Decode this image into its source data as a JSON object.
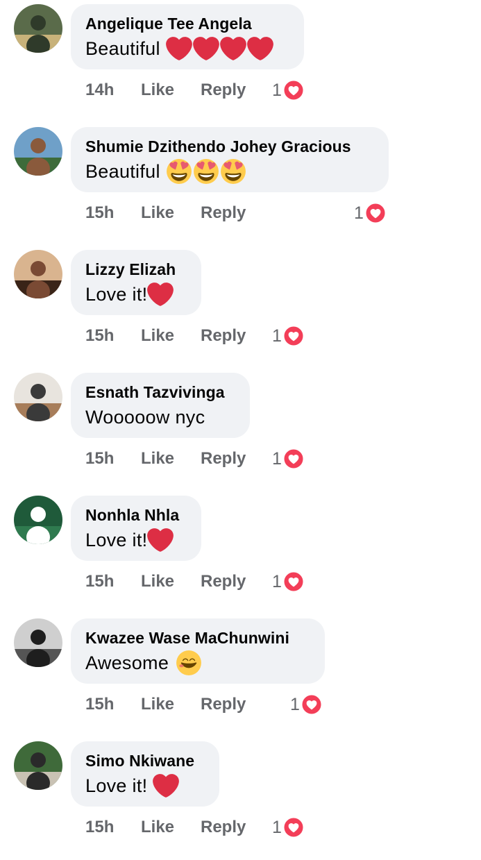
{
  "comments": [
    {
      "author": "Angelique Tee Angela",
      "text": "Beautiful",
      "emoji": "red-heart-icon",
      "emoji_count": 4,
      "time": "14h",
      "like": "Like",
      "reply": "Reply",
      "reaction_count": "1",
      "avatar_colors": [
        "#5a6b4a",
        "#c8b27a",
        "#2f3a2a"
      ]
    },
    {
      "author": "Shumie Dzithendo Johey Gracious",
      "text": "Beautiful",
      "emoji": "heart-eyes-face-icon",
      "emoji_count": 3,
      "time": "15h",
      "like": "Like",
      "reply": "Reply",
      "reaction_count": "1",
      "avatar_colors": [
        "#6fa0c8",
        "#3d6b3a",
        "#8a5a3c"
      ]
    },
    {
      "author": "Lizzy Elizah",
      "text": "Love it!",
      "emoji": "red-heart-icon",
      "emoji_count": 1,
      "time": "15h",
      "like": "Like",
      "reply": "Reply",
      "reaction_count": "1",
      "avatar_colors": [
        "#d9b48f",
        "#3a2418",
        "#7a4a34"
      ]
    },
    {
      "author": "Esnath Tazvivinga",
      "text": "Wooooow nyc",
      "emoji": "",
      "emoji_count": 0,
      "time": "15h",
      "like": "Like",
      "reply": "Reply",
      "reaction_count": "1",
      "avatar_colors": [
        "#e8e4de",
        "#a77d5a",
        "#3a3a3a"
      ]
    },
    {
      "author": "Nonhla Nhla",
      "text": "Love it!",
      "emoji": "red-heart-icon",
      "emoji_count": 1,
      "time": "15h",
      "like": "Like",
      "reply": "Reply",
      "reaction_count": "1",
      "avatar_colors": [
        "#1f5a3a",
        "#2f7a4f",
        "#ffffff"
      ]
    },
    {
      "author": "Kwazee Wase MaChunwini",
      "text": "Awesome",
      "emoji": "smiling-face-icon",
      "emoji_count": 1,
      "time": "15h",
      "like": "Like",
      "reply": "Reply",
      "reaction_count": "1",
      "avatar_colors": [
        "#cfcfcf",
        "#555555",
        "#1e1e1e"
      ]
    },
    {
      "author": "Simo Nkiwane",
      "text": "Love it!",
      "emoji": "red-heart-icon",
      "emoji_count": 1,
      "time": "15h",
      "like": "Like",
      "reply": "Reply",
      "reaction_count": "1",
      "avatar_colors": [
        "#3f6a3a",
        "#c9c2b4",
        "#2a2a2a"
      ]
    }
  ],
  "reaction_icon": "love-reaction-icon",
  "colors": {
    "bubble": "#f0f2f5",
    "meta_text": "#65676b",
    "love_red": "#f33e58",
    "heart_red": "#e8192c",
    "emoji_yellow": "#ffcc4d"
  }
}
